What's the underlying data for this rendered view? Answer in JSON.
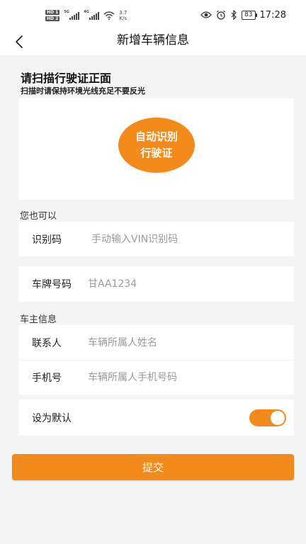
{
  "status_bar": {
    "hd1": "HD 1",
    "hd2": "HD 2",
    "net1": "5G",
    "net2": "4G",
    "speed_value": "3.7",
    "speed_unit": "K/s",
    "battery": "83",
    "time": "17:28",
    "icons": [
      "eye-icon",
      "alarm-icon",
      "bluetooth-icon"
    ]
  },
  "header": {
    "title": "新增车辆信息",
    "back_icon": "chevron-left-icon"
  },
  "scan": {
    "title": "请扫描行驶证正面",
    "tip": "扫描时请保持环境光线充足不要反光",
    "button_line1": "自动识别",
    "button_line2": "行驶证"
  },
  "alt_section": {
    "label": "您也可以"
  },
  "vin": {
    "label": "识别码",
    "placeholder": "手动输入VIN识别码",
    "value": ""
  },
  "plate": {
    "label": "车牌号码",
    "placeholder": "甘AA1234",
    "value": ""
  },
  "owner_section": {
    "label": "车主信息"
  },
  "contact": {
    "label": "联系人",
    "placeholder": "车辆所属人姓名",
    "value": ""
  },
  "phone": {
    "label": "手机号",
    "placeholder": "车辆所属人手机号码",
    "value": ""
  },
  "default_setting": {
    "label": "设为默认",
    "enabled": true
  },
  "submit": {
    "label": "提交"
  },
  "colors": {
    "accent": "#f28a1c",
    "background": "#f4f4f4",
    "card": "#ffffff",
    "placeholder": "#9a9a9a"
  }
}
